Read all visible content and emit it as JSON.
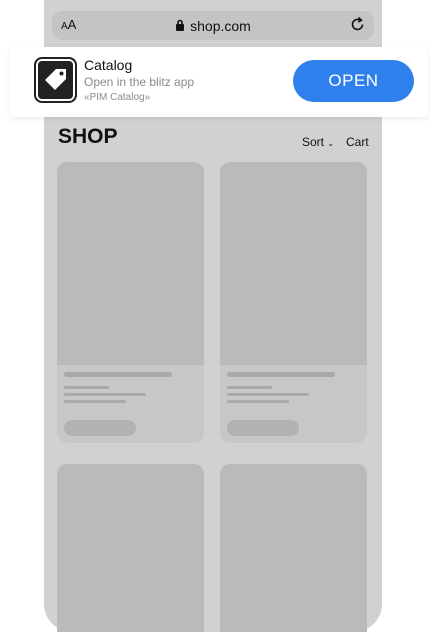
{
  "browser": {
    "text_size_label": "AA",
    "url": "shop.com",
    "icons": [
      "text-size-icon",
      "lock-icon",
      "reload-icon"
    ]
  },
  "smart_banner": {
    "app_name": "Catalog",
    "subtitle": "Open in the blitz app",
    "caption": "«PIM Catalog»",
    "open_label": "OPEN",
    "accent_color": "#2f80ed",
    "icon": "price-tag-icon"
  },
  "shop": {
    "title": "SHOP",
    "sort_label": "Sort",
    "cart_label": "Cart"
  },
  "products": [
    {
      "placeholder": true
    },
    {
      "placeholder": true
    },
    {
      "placeholder": true
    },
    {
      "placeholder": true
    }
  ]
}
